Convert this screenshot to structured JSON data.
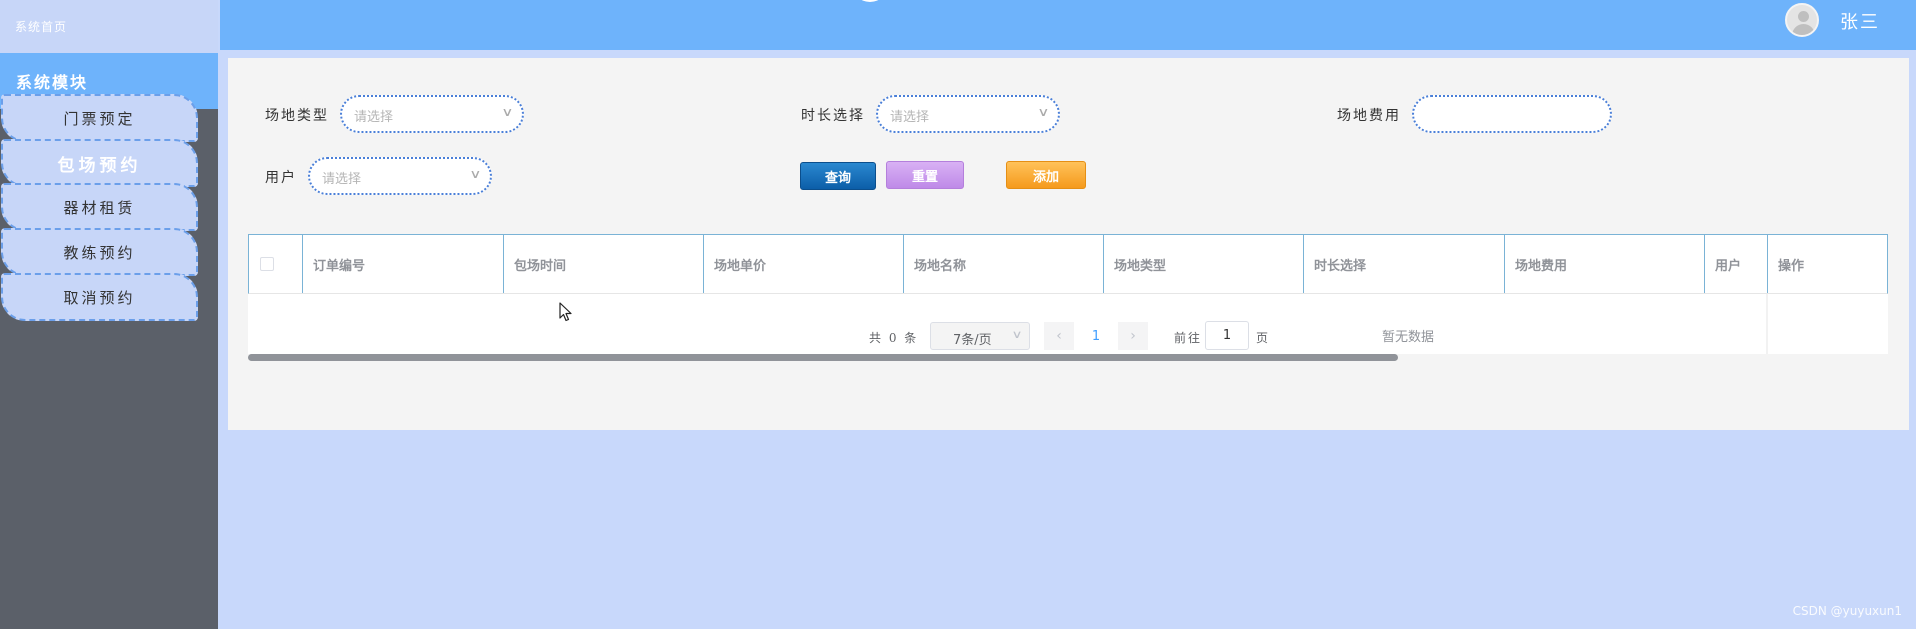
{
  "sidebar": {
    "home_label": "系统首页",
    "module_label": "系统模块",
    "items": [
      {
        "label": "门票预定"
      },
      {
        "label": "包场预约"
      },
      {
        "label": "器材租赁"
      },
      {
        "label": "教练预约"
      },
      {
        "label": "取消预约"
      }
    ],
    "active_index": 1
  },
  "header": {
    "username": "张三"
  },
  "filters": {
    "venue_type": {
      "label": "场地类型",
      "placeholder": "请选择"
    },
    "duration": {
      "label": "时长选择",
      "placeholder": "请选择"
    },
    "venue_fee": {
      "label": "场地费用",
      "value": ""
    },
    "user": {
      "label": "用户",
      "placeholder": "请选择"
    }
  },
  "buttons": {
    "query": "查询",
    "reset": "重置",
    "add": "添加"
  },
  "table": {
    "columns": [
      "订单编号",
      "包场时间",
      "场地单价",
      "场地名称",
      "场地类型",
      "时长选择",
      "场地费用",
      "用户",
      "操作"
    ],
    "rows": [],
    "empty_text": "暂无数据"
  },
  "pagination": {
    "total_text": "共 0 条",
    "page_size": "7条/页",
    "prev": "‹",
    "current_page": "1",
    "next": "›",
    "goto_label": "前往",
    "goto_value": "1",
    "page_suffix": "页"
  },
  "watermark": "CSDN @yuyuxun1",
  "colors": {
    "header": "#6eb3fb",
    "sidebar": "#5b6069",
    "menu_item": "#c7d6f8",
    "page_bg": "#c8d8fb",
    "query_button": "#1a72bc",
    "reset_button": "#cc9bee",
    "add_button": "#f8a93a"
  },
  "icons": {
    "avatar": "user-avatar-icon",
    "select_chevron": "chevron-down-icon",
    "cursor": "mouse-pointer-icon"
  }
}
